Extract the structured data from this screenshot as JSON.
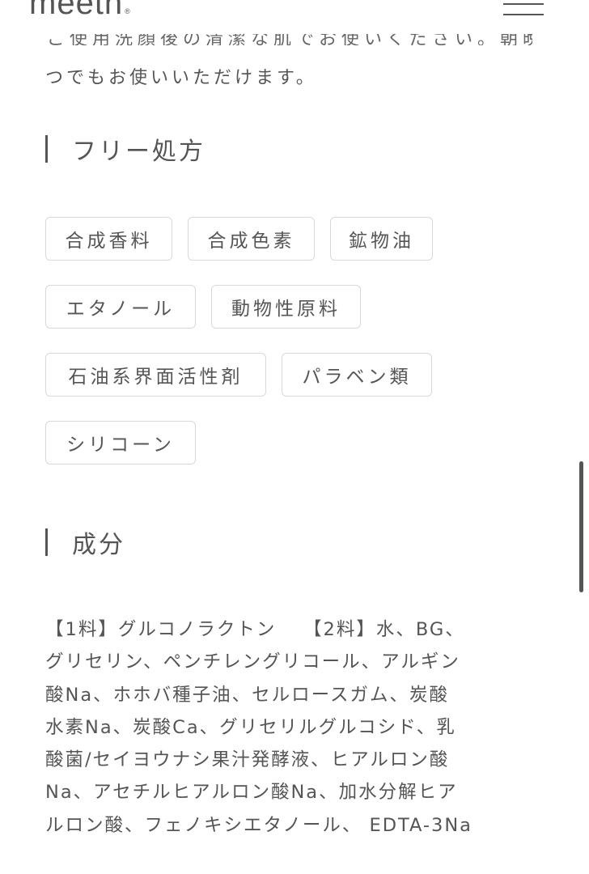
{
  "header": {
    "logo": "meeth",
    "logo_mark": "®",
    "menu_icon": "hamburger-menu-icon"
  },
  "intro": {
    "cut_line": "ご使用洗顔後の清潔な肌でお使いください。朝晩問わずい",
    "line": "つでもお使いいただけます。"
  },
  "free_formula": {
    "heading": "フリー処方",
    "tags": [
      "合成香料",
      "合成色素",
      "鉱物油",
      "エタノール",
      "動物性原料",
      "石油系界面活性剤",
      "パラベン類",
      "シリコーン"
    ]
  },
  "ingredients": {
    "heading": "成分",
    "lines": [
      "【1料】グルコノラクトン　 【2料】水、BG、",
      "グリセリン、ペンチレングリコール、アルギン",
      "酸Na、ホホバ種子油、セルロースガム、炭酸",
      "水素Na、炭酸Ca、グリセリルグルコシド、乳",
      "酸菌/セイヨウナシ果汁発酵液、ヒアルロン酸",
      "Na、アセチルヒアルロン酸Na、加水分解ヒア",
      "ルロン酸、フェノキシエタノール、 EDTA-3Na"
    ]
  },
  "colors": {
    "text": "#555555",
    "tag_border": "#d9d9d9",
    "background": "#ffffff"
  }
}
